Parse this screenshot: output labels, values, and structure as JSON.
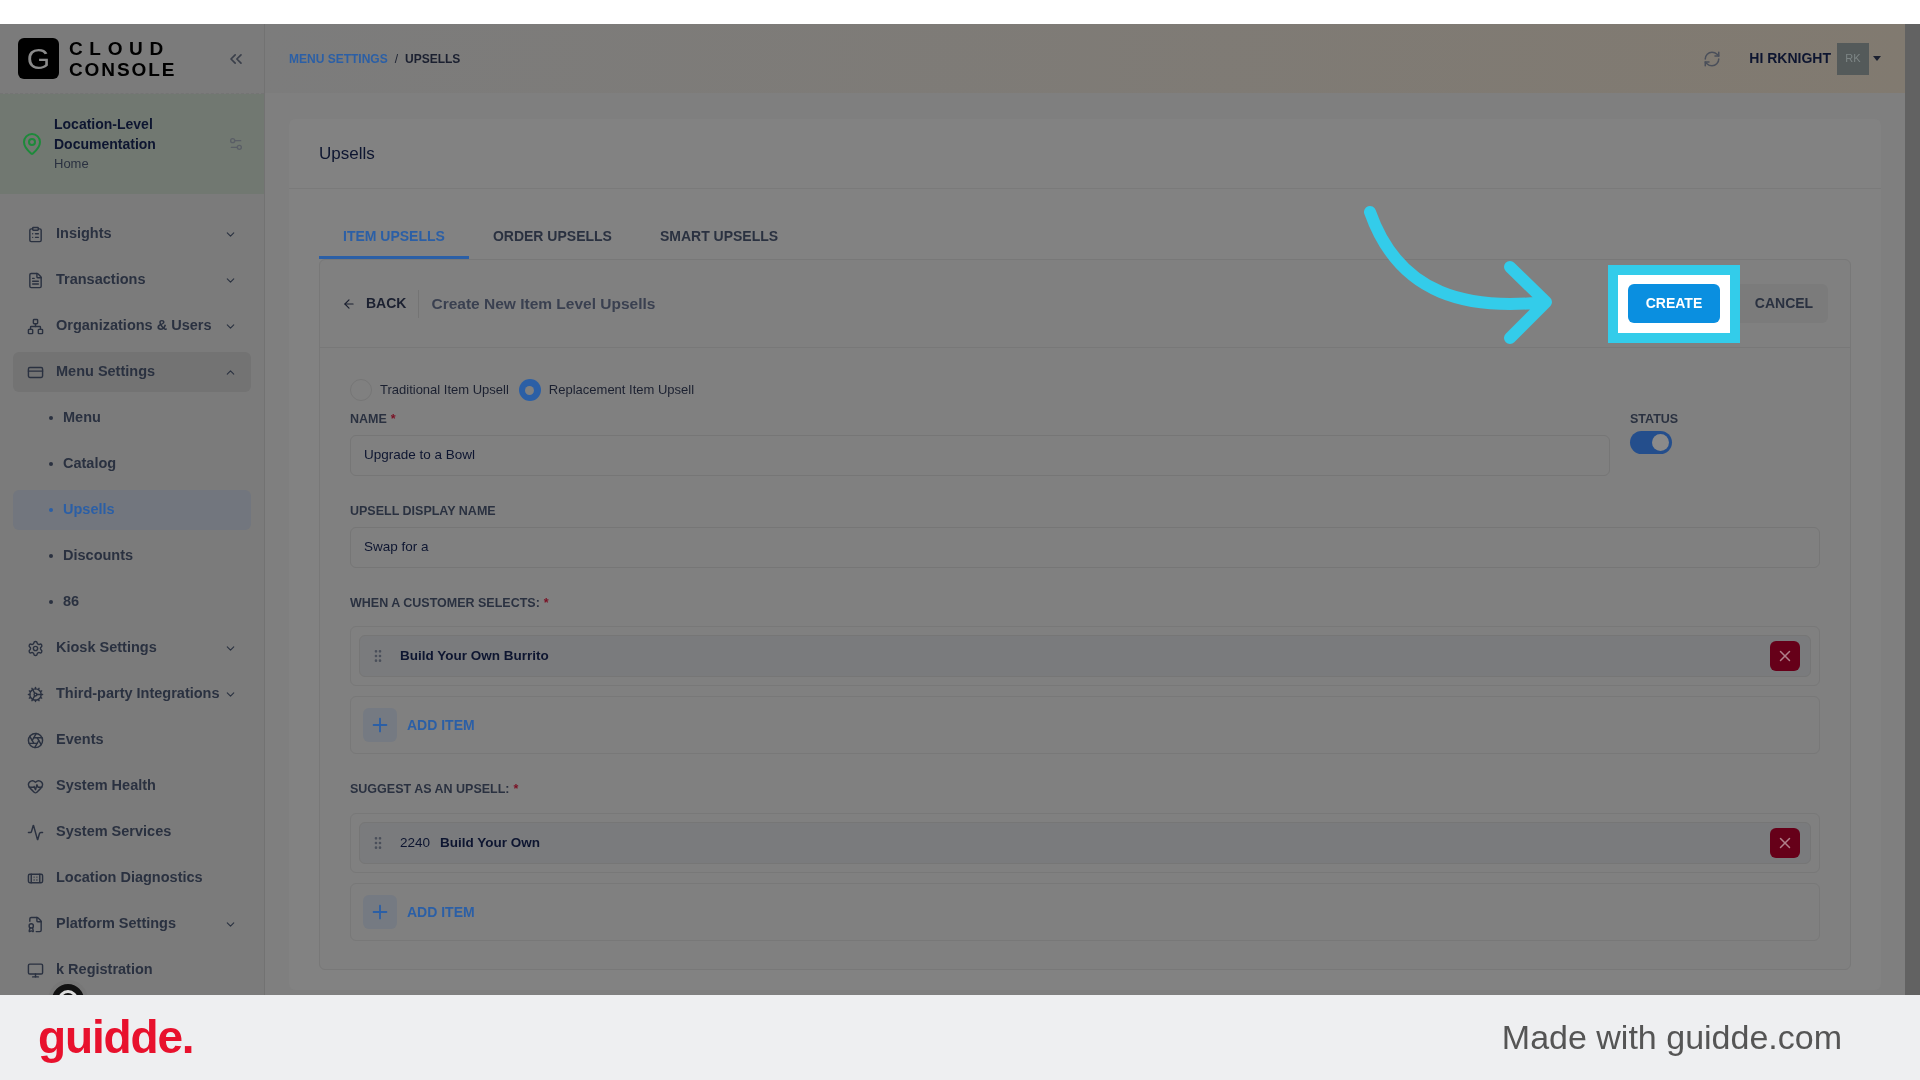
{
  "logo": {
    "mark": "G",
    "line1": "CLOUD",
    "line2": "CONSOLE"
  },
  "location": {
    "name": "Location-Level Documentation",
    "subtitle": "Home"
  },
  "nav": [
    {
      "label": "Insights",
      "expandable": true,
      "expanded": false
    },
    {
      "label": "Transactions",
      "expandable": true,
      "expanded": false
    },
    {
      "label": "Organizations & Users",
      "expandable": true,
      "expanded": false
    },
    {
      "label": "Menu Settings",
      "expandable": true,
      "expanded": true,
      "children": [
        {
          "label": "Menu",
          "selected": false
        },
        {
          "label": "Catalog",
          "selected": false
        },
        {
          "label": "Upsells",
          "selected": true
        },
        {
          "label": "Discounts",
          "selected": false
        },
        {
          "label": "86",
          "selected": false
        }
      ]
    },
    {
      "label": "Kiosk Settings",
      "expandable": true,
      "expanded": false
    },
    {
      "label": "Third-party Integrations",
      "expandable": true,
      "expanded": false
    },
    {
      "label": "Events",
      "expandable": false
    },
    {
      "label": "System Health",
      "expandable": false
    },
    {
      "label": "System Services",
      "expandable": false
    },
    {
      "label": "Location Diagnostics",
      "expandable": false
    },
    {
      "label": "Platform Settings",
      "expandable": true,
      "expanded": false
    },
    {
      "label": "k Registration",
      "expandable": false
    }
  ],
  "breadcrumb": [
    {
      "label": "MENU SETTINGS",
      "kind": "link"
    },
    {
      "label": "/",
      "kind": "separator"
    },
    {
      "label": "UPSELLS",
      "kind": "current"
    }
  ],
  "user": {
    "greeting": "HI RKNIGHT",
    "initials": "RK"
  },
  "page_title": "Upsells",
  "tabs": [
    {
      "label": "ITEM UPSELLS",
      "selected": true
    },
    {
      "label": "ORDER UPSELLS",
      "selected": false
    },
    {
      "label": "SMART UPSELLS",
      "selected": false
    }
  ],
  "form_header": {
    "back": "BACK",
    "title": "Create New Item Level Upsells",
    "primary": "CREATE",
    "secondary": "CANCEL"
  },
  "upsell_types": [
    {
      "label": "Traditional Item Upsell",
      "selected": false
    },
    {
      "label": "Replacement Item Upsell",
      "selected": true
    }
  ],
  "name_field": {
    "label": "NAME",
    "required_mark": "*",
    "value": "Upgrade to a Bowl"
  },
  "status": {
    "label": "STATUS",
    "on": true
  },
  "display_name_field": {
    "label": "UPSELL DISPLAY NAME",
    "value": "Swap for a"
  },
  "sections": [
    {
      "label": "WHEN A CUSTOMER SELECTS:",
      "required_mark": "*",
      "items": [
        {
          "name": "Build Your Own Burrito"
        }
      ],
      "add_label": "ADD ITEM"
    },
    {
      "label": "SUGGEST AS AN UPSELL:",
      "required_mark": "*",
      "items": [
        {
          "code": "2240",
          "name": "Build Your Own"
        }
      ],
      "add_label": "ADD ITEM"
    }
  ],
  "footer": {
    "brand": "guidde.",
    "credit": "Made with guidde.com"
  }
}
